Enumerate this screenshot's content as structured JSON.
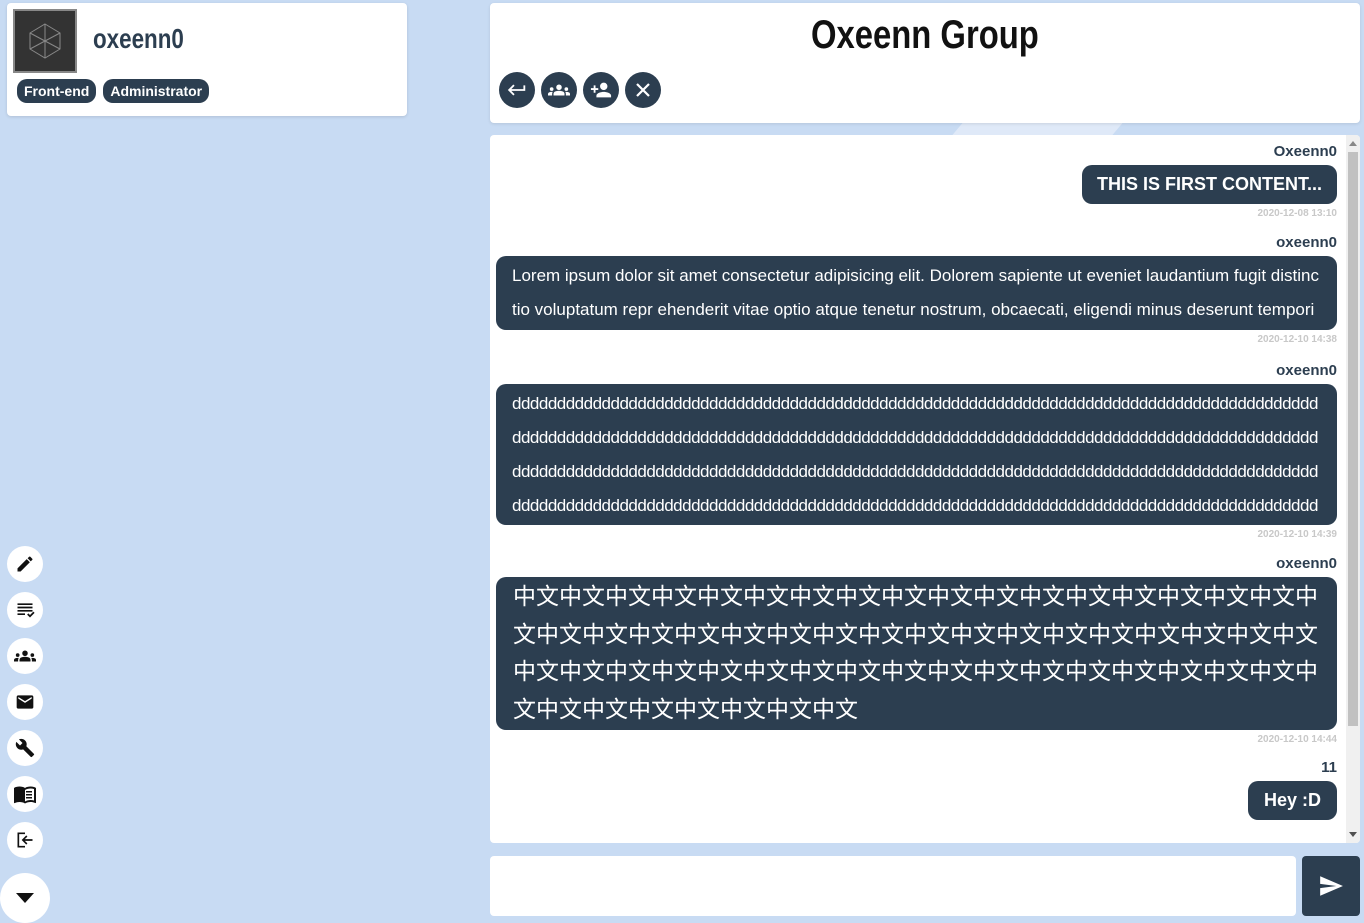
{
  "profile": {
    "username": "oxeenn0",
    "tags": [
      "Front-end",
      "Administrator"
    ]
  },
  "sidebar": {
    "icons": [
      "edit-icon",
      "notes-icon",
      "groups-icon",
      "mail-icon",
      "wrench-icon",
      "book-icon",
      "logout-icon",
      "caret-down-icon"
    ]
  },
  "header": {
    "title": "Oxeenn Group",
    "buttons": [
      "back-icon",
      "members-icon",
      "add-member-icon",
      "close-icon"
    ]
  },
  "messages": [
    {
      "sender": "Oxeenn0",
      "text": "THIS IS FIRST CONTENT...",
      "time": "2020-12-08 13:10"
    },
    {
      "sender": "oxeenn0",
      "text": "Lorem ipsum dolor sit amet consectetur adipisicing elit. Dolorem sapiente ut eveniet laudantium fugit distinctio voluptatum repr ehenderit vitae optio atque tenetur nostrum, obcaecati, eligendi minus deserunt temporibus velit. Et, nam.",
      "time": "2020-12-10 14:38"
    },
    {
      "sender": "oxeenn0",
      "text": "dddddddddddddddddddddddddddddddddddddddddddddddddddddddddddddddddddddddddddddddddddddddddddddddddddddddddddddddddddddddddddddddddddddddddddddddddddddddddddddddddddddddddddddddddddddddddddddddddddddddddddddddddddddddddddddddddddddddddddddddddddddddddddddddddddddddddddddddddddddddddddddddddddddddddddddddddddddddddddddddddddddddddddddddddddddddddddddddddddddddddddddddddddddddddddd",
      "time": "2020-12-10 14:39"
    },
    {
      "sender": "oxeenn0",
      "text": "中文中文中文中文中文中文中文中文中文中文中文中文中文中文中文中文中文中文中文中文中文中文中文中文中文中文中文中文中文中文中文中文中文中文中文中文中文中文中文中文中文中文中文中文中文中文中文中文中文中文中文中文中文中文中文中文中文中文中文中文",
      "time": "2020-12-10 14:44"
    },
    {
      "sender": "11",
      "text": "Hey :D",
      "time": ""
    }
  ],
  "input": {
    "value": ""
  },
  "colors": {
    "background": "#c8dbf3",
    "accent": "#2c3e50",
    "panel": "#ffffff"
  }
}
